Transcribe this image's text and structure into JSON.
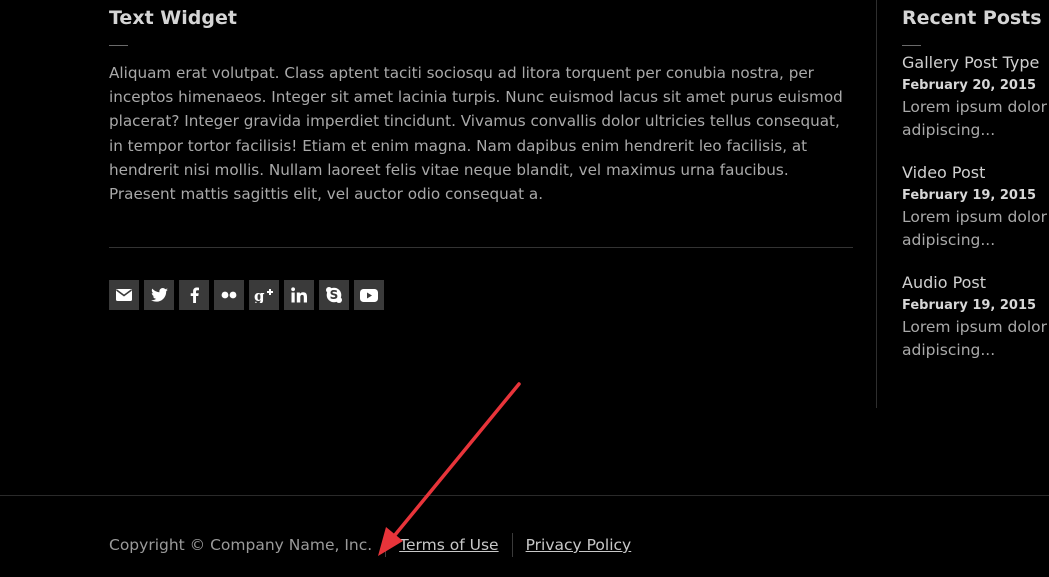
{
  "text_widget": {
    "title": "Text Widget",
    "body": "Aliquam erat volutpat. Class aptent taciti sociosqu ad litora torquent per conubia nostra, per inceptos himenaeos. Integer sit amet lacinia turpis. Nunc euismod lacus sit amet purus euismod placerat? Integer gravida imperdiet tincidunt. Vivamus convallis dolor ultricies tellus consequat, in tempor tortor facilisis! Etiam et enim magna. Nam dapibus enim hendrerit leo facilisis, at hendrerit nisi mollis. Nullam laoreet felis vitae neque blandit, vel maximus urna faucibus. Praesent mattis sagittis elit, vel auctor odio consequat a."
  },
  "social": [
    {
      "icon": "email-icon"
    },
    {
      "icon": "twitter-icon"
    },
    {
      "icon": "facebook-icon"
    },
    {
      "icon": "flickr-icon"
    },
    {
      "icon": "google-plus-icon"
    },
    {
      "icon": "linkedin-icon"
    },
    {
      "icon": "skype-icon"
    },
    {
      "icon": "youtube-icon"
    }
  ],
  "recent_posts": {
    "title": "Recent Posts",
    "posts": [
      {
        "title": "Gallery Post Type",
        "date": "February 20, 2015",
        "excerpt_line1": "Lorem ipsum dolor",
        "excerpt_line2": "adipiscing..."
      },
      {
        "title": "Video Post",
        "date": "February 19, 2015",
        "excerpt_line1": "Lorem ipsum dolor",
        "excerpt_line2": "adipiscing..."
      },
      {
        "title": "Audio Post",
        "date": "February 19, 2015",
        "excerpt_line1": "Lorem ipsum dolor",
        "excerpt_line2": "adipiscing..."
      }
    ]
  },
  "footer": {
    "copyright": "Copyright © Company Name, Inc.",
    "terms_label": "Terms of Use",
    "privacy_label": "Privacy Policy"
  },
  "colors": {
    "background": "#000000",
    "social_button": "#3a3a3a",
    "annotation_arrow": "#e8343a"
  }
}
